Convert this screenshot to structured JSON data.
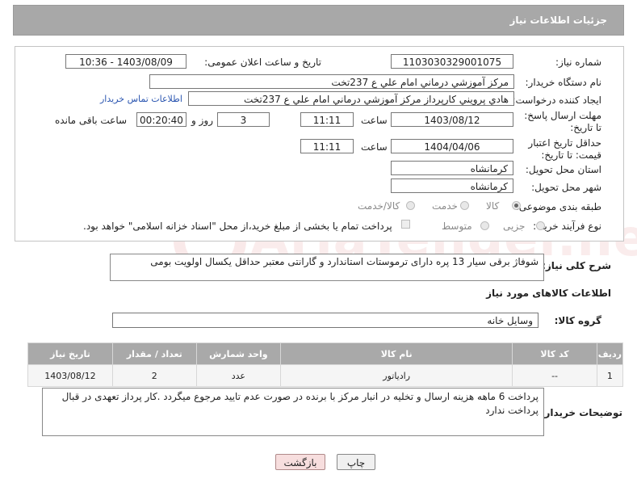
{
  "header": {
    "title": "جزئیات اطلاعات نیاز"
  },
  "watermark": {
    "text": "AriaTender.net"
  },
  "form": {
    "need_number": {
      "label": "شماره نیاز:",
      "value": "1103030329001075"
    },
    "announce": {
      "label": "تاریخ و ساعت اعلان عمومی:",
      "value": "1403/08/09 - 10:36"
    },
    "buyer": {
      "label": "نام دستگاه خریدار:",
      "value": "مرکز آموزشي درماني امام علي ع 237تخت"
    },
    "creator": {
      "label": "ایجاد کننده درخواست:",
      "value": "هادي پرويني كارپرداز  مرکز آموزشي درماني امام علي ع 237تخت",
      "contact_link": "اطلاعات تماس خریدار"
    },
    "deadline": {
      "label": "مهلت ارسال پاسخ: تا تاریخ:",
      "date": "1403/08/12",
      "time_label": "ساعت",
      "time": "11:11",
      "days": "3",
      "days_label": "روز و",
      "remaining": "00:20:40",
      "remaining_label": "ساعت باقی مانده"
    },
    "validity": {
      "label": "حداقل تاریخ اعتبار قیمت: تا تاریخ:",
      "date": "1404/04/06",
      "time_label": "ساعت",
      "time": "11:11"
    },
    "province": {
      "label": "استان محل تحویل:",
      "value": "کرمانشاه"
    },
    "city": {
      "label": "شهر محل تحویل:",
      "value": "کرمانشاه"
    },
    "category": {
      "label": "طبقه بندی موضوعی:",
      "options": [
        "کالا",
        "خدمت",
        "کالا/خدمت"
      ],
      "selected": "کالا"
    },
    "purchase_type": {
      "label": "نوع فرآیند خرید :",
      "options": [
        "جزیی",
        "متوسط"
      ],
      "payment_note": "پرداخت تمام یا بخشی از مبلغ خرید،از محل \"اسناد خزانه اسلامی\" خواهد بود."
    }
  },
  "description": {
    "label": "شرح کلی نیاز:",
    "value": "شوفاژ برقی سیار 13 پره دارای ترموستات استاندارد و گارانتی  معتبر حداقل یکسال  اولویت بومی"
  },
  "goods": {
    "section_title": "اطلاعات کالاهای مورد نیاز",
    "group_label": "گروه کالا:",
    "group_value": "وسایل خانه",
    "columns": [
      "ردیف",
      "کد کالا",
      "نام کالا",
      "واحد شمارش",
      "تعداد / مقدار",
      "تاریخ نیاز"
    ],
    "rows": [
      [
        "1",
        "--",
        "رادیاتور",
        "عدد",
        "2",
        "1403/08/12"
      ]
    ]
  },
  "buyer_notes": {
    "label": "توضیحات خریدار:",
    "value": "پرداخت  6 ماهه هزینه  ارسال و تخلیه  در  انبار مرکز با برنده در صورت عدم تایید مرجوع میگردد .کار پرداز تعهدی در قبال پرداخت ندارد"
  },
  "buttons": {
    "print": "چاپ",
    "back": "بازگشت"
  }
}
